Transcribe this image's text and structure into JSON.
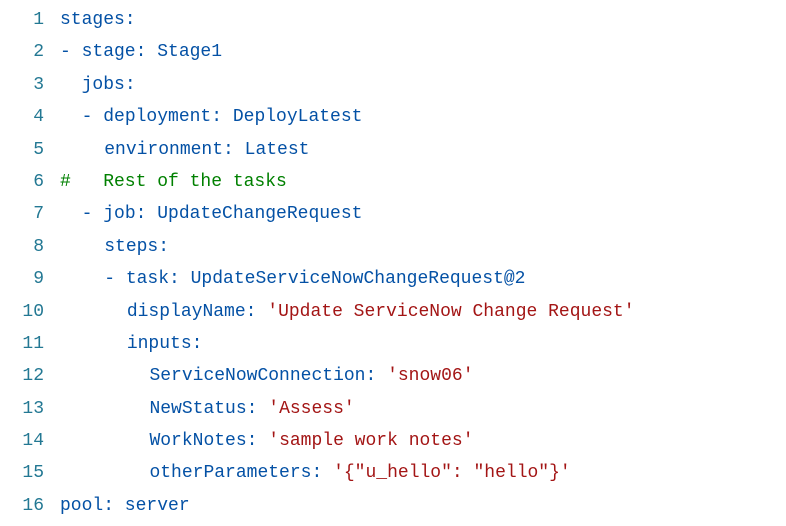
{
  "lines": [
    {
      "num": "1",
      "indent": "",
      "text": "stages:",
      "cls": "key",
      "guides": []
    },
    {
      "num": "2",
      "indent": "",
      "text": "- stage: Stage1",
      "cls": "key",
      "guides": []
    },
    {
      "num": "3",
      "indent": "  ",
      "text": "jobs:",
      "cls": "key",
      "guides": [
        2
      ]
    },
    {
      "num": "4",
      "indent": "  ",
      "text": "- deployment: DeployLatest",
      "cls": "key",
      "guides": [
        2
      ]
    },
    {
      "num": "5",
      "indent": "    ",
      "text": "environment: Latest",
      "cls": "key",
      "guides": [
        2,
        4
      ]
    },
    {
      "num": "6",
      "indent": "",
      "text": "#   Rest of the tasks",
      "cls": "comment",
      "guides": []
    },
    {
      "num": "7",
      "indent": "  ",
      "text": "- job: UpdateChangeRequest",
      "cls": "key",
      "guides": [
        2
      ]
    },
    {
      "num": "8",
      "indent": "    ",
      "text": "steps:",
      "cls": "key",
      "guides": [
        2,
        4
      ]
    },
    {
      "num": "9",
      "indent": "    ",
      "text": "- task: UpdateServiceNowChangeRequest@2",
      "cls": "key",
      "guides": [
        2,
        4
      ]
    },
    {
      "num": "10",
      "indent": "      ",
      "text": "displayName: 'Update ServiceNow Change Request'",
      "cls": "mixed",
      "guides": [
        2,
        4,
        6
      ],
      "keypart": "displayName: ",
      "strpart": "'Update ServiceNow Change Request'"
    },
    {
      "num": "11",
      "indent": "      ",
      "text": "inputs:",
      "cls": "key",
      "guides": [
        2,
        4,
        6
      ]
    },
    {
      "num": "12",
      "indent": "        ",
      "text": "ServiceNowConnection: 'snow06'",
      "cls": "mixed",
      "guides": [
        2,
        4,
        6,
        8
      ],
      "keypart": "ServiceNowConnection: ",
      "strpart": "'snow06'"
    },
    {
      "num": "13",
      "indent": "        ",
      "text": "NewStatus: 'Assess'",
      "cls": "mixed",
      "guides": [
        2,
        4,
        6,
        8
      ],
      "keypart": "NewStatus: ",
      "strpart": "'Assess'"
    },
    {
      "num": "14",
      "indent": "        ",
      "text": "WorkNotes: 'sample work notes'",
      "cls": "mixed",
      "guides": [
        2,
        4,
        6,
        8
      ],
      "keypart": "WorkNotes: ",
      "strpart": "'sample work notes'"
    },
    {
      "num": "15",
      "indent": "        ",
      "text": "otherParameters: '{\"u_hello\": \"hello\"}'",
      "cls": "mixed",
      "guides": [
        2,
        4,
        6,
        8
      ],
      "keypart": "otherParameters: ",
      "strpart": "'{\"u_hello\": \"hello\"}'"
    },
    {
      "num": "16",
      "indent": "",
      "text": "pool: server",
      "cls": "key",
      "guides": []
    }
  ],
  "chart_data": {
    "type": "table",
    "title": "YAML pipeline snippet",
    "content": "stages:\n- stage: Stage1\n  jobs:\n  - deployment: DeployLatest\n    environment: Latest\n#   Rest of the tasks\n  - job: UpdateChangeRequest\n    steps:\n    - task: UpdateServiceNowChangeRequest@2\n      displayName: 'Update ServiceNow Change Request'\n      inputs:\n        ServiceNowConnection: 'snow06'\n        NewStatus: 'Assess'\n        WorkNotes: 'sample work notes'\n        otherParameters: '{\"u_hello\": \"hello\"}'\npool: server"
  }
}
